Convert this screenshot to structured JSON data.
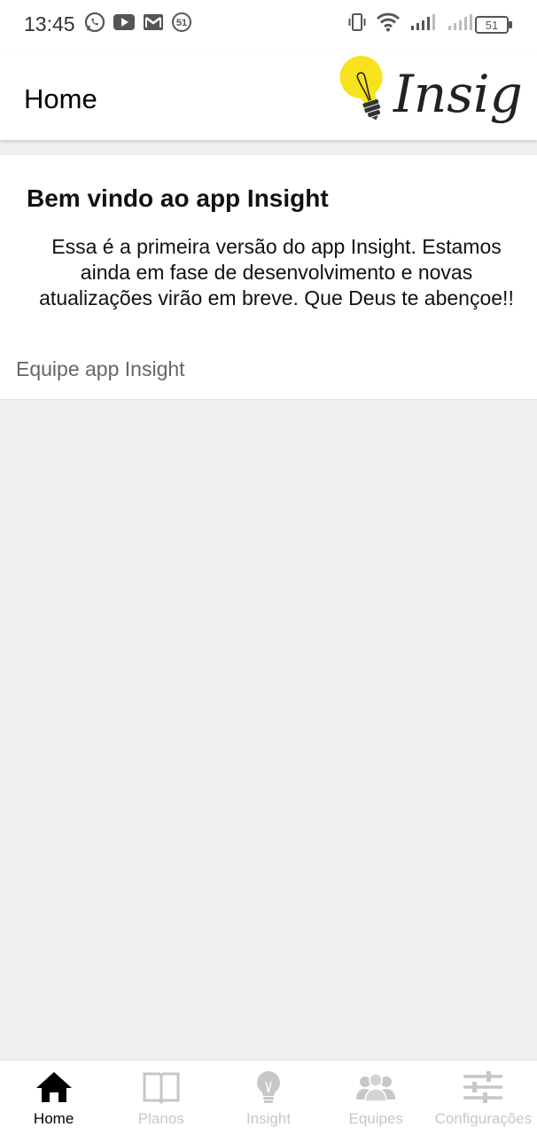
{
  "status_bar": {
    "time": "13:45",
    "notification_badge": "51",
    "battery_level": "51",
    "left_icons": [
      "whatsapp-icon",
      "youtube-icon",
      "gmail-icon",
      "badge-51-icon"
    ],
    "right_icons": [
      "vibrate-icon",
      "wifi-icon",
      "signal-icon",
      "signal-icon",
      "battery-icon"
    ]
  },
  "app_bar": {
    "title": "Home",
    "logo_text": "Insight",
    "logo_color": "#f7e21b"
  },
  "card": {
    "title": "Bem vindo ao app Insight",
    "body": "Essa é a primeira versão do app Insight. Estamos ainda em fase de desenvolvimento e novas atualizações virão em breve. Que Deus te abençoe!!",
    "footer": "Equipe app Insight"
  },
  "bottom_nav": {
    "items": [
      {
        "label": "Home",
        "icon": "home-icon",
        "active": true
      },
      {
        "label": "Planos",
        "icon": "book-icon",
        "active": false
      },
      {
        "label": "Insight",
        "icon": "lightbulb-icon",
        "active": false
      },
      {
        "label": "Equipes",
        "icon": "group-icon",
        "active": false
      },
      {
        "label": "Configurações",
        "icon": "sliders-icon",
        "active": false
      }
    ],
    "active_color": "#000000",
    "inactive_color": "#c7c7c7"
  }
}
